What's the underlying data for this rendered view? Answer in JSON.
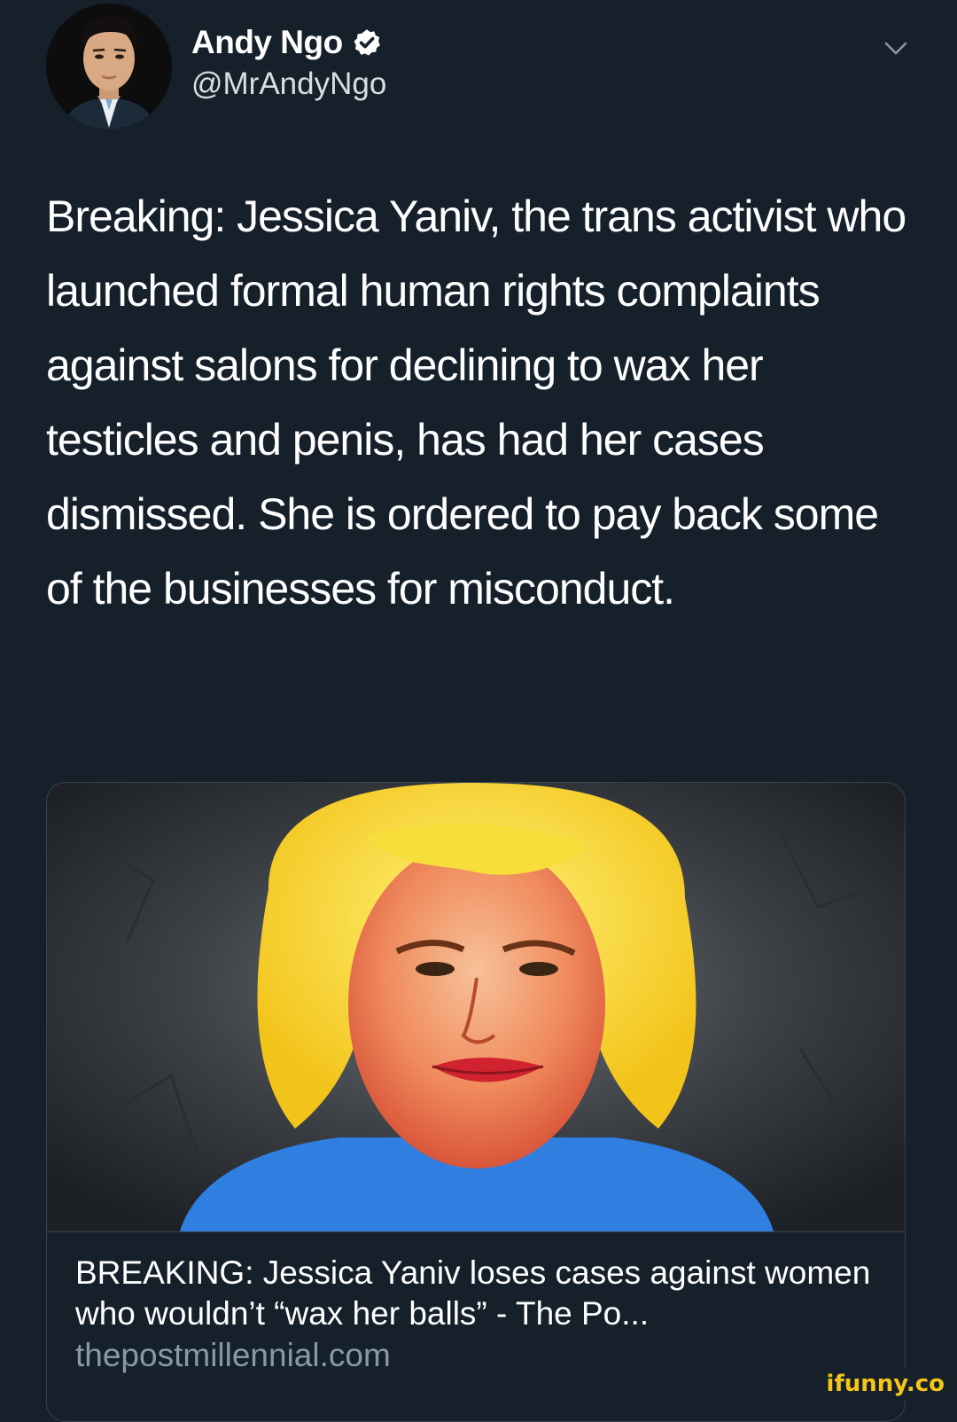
{
  "author": {
    "display_name": "Andy Ngo",
    "handle": "@MrAndyNgo",
    "verified": true,
    "avatar_icon": "profile-photo"
  },
  "tweet": {
    "text": "Breaking: Jessica Yaniv, the trans activist who launched formal human rights complaints against salons for declining to wax her testicles and penis, has had her cases dismissed. She is ordered to pay back some of the businesses for misconduct."
  },
  "link_card": {
    "title": "BREAKING: Jessica Yaniv loses cases against women who wouldn’t “wax her balls” - The Po...",
    "domain": "thepostmillennial.com"
  },
  "watermark": {
    "text": "ifunny.co"
  },
  "colors": {
    "background": "#15202b",
    "text_primary": "#ffffff",
    "text_secondary": "#8899a6",
    "border": "#38444d",
    "watermark": "#f5c518"
  },
  "icons": {
    "verified": "verified-badge-icon",
    "menu": "chevron-down-icon"
  }
}
